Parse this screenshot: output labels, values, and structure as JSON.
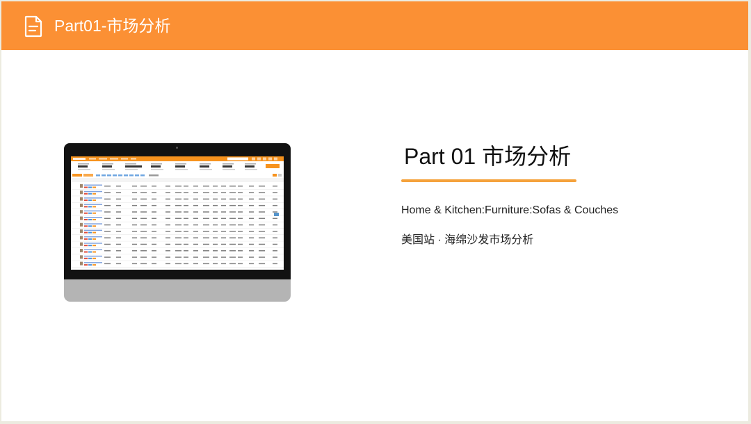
{
  "header": {
    "title": "Part01-市场分析",
    "icon": "document-icon",
    "background": "#fb9034"
  },
  "main": {
    "title": "Part 01  市场分析",
    "subtitle": "Home & Kitchen:Furniture:Sofas & Couches",
    "description": "美国站 · 海绵沙发市场分析",
    "accent": "#f5a23c"
  },
  "monitor": {
    "screen_content": "market-data-table-screenshot",
    "app_accent": "#f7931e"
  }
}
